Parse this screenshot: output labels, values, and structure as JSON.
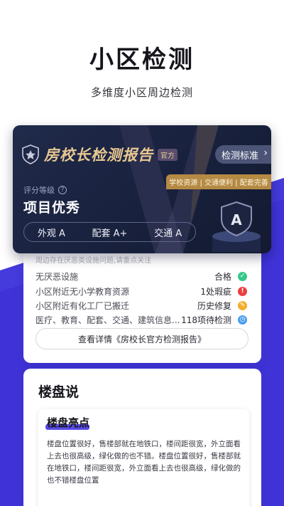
{
  "hero": {
    "title": "小区检测",
    "subtitle": "多维度小区周边检测"
  },
  "report": {
    "title": "房校长检测报告",
    "official_badge": "官方",
    "standard_button": "检测标准",
    "tags": "学校资源 | 交通便利 | 配套完善",
    "rating_label": "评分等级",
    "rating_value": "项目优秀",
    "grade_letter": "A",
    "sub_ratings": [
      {
        "label": "外观 A"
      },
      {
        "label": "配套 A+"
      },
      {
        "label": "交通 A"
      }
    ]
  },
  "checks": {
    "note": "周边存在厌恶类设施问题,请重点关注",
    "items": [
      {
        "label": "无厌恶设施",
        "value": "合格",
        "icon": "check-icon",
        "color": "#37c98a",
        "glyph": "✓"
      },
      {
        "label": "小区附近无小学教育资源",
        "value": "1处瑕疵",
        "icon": "alert-icon",
        "color": "#ec3f3f",
        "glyph": "!"
      },
      {
        "label": "小区附近有化工厂已搬迁",
        "value": "历史修复",
        "icon": "wrench-icon",
        "color": "#f2ae2d",
        "glyph": "✎"
      },
      {
        "label": "医疗、教育、配套、交通、建筑信息...",
        "value": "118项待检测",
        "icon": "clock-icon",
        "color": "#4a9ef0",
        "glyph": "◷"
      }
    ],
    "detail_button": "查看详情《房校长官方检测报告》"
  },
  "section": {
    "title": "楼盘说",
    "highlight_title": "楼盘亮点",
    "highlight_text": "楼盘位置很好，售楼部就在地铁口，楼间距很宽，外立面看上去也很高级，绿化做的也不错。楼盘位置很好，售楼部就在地铁口，楼间距很宽，外立面看上去也很高级，绿化做的也不错楼盘位置"
  },
  "colors": {
    "accent_purple": "#3f33d8",
    "report_dark": "#1b2340",
    "gold": "#e9c891"
  }
}
